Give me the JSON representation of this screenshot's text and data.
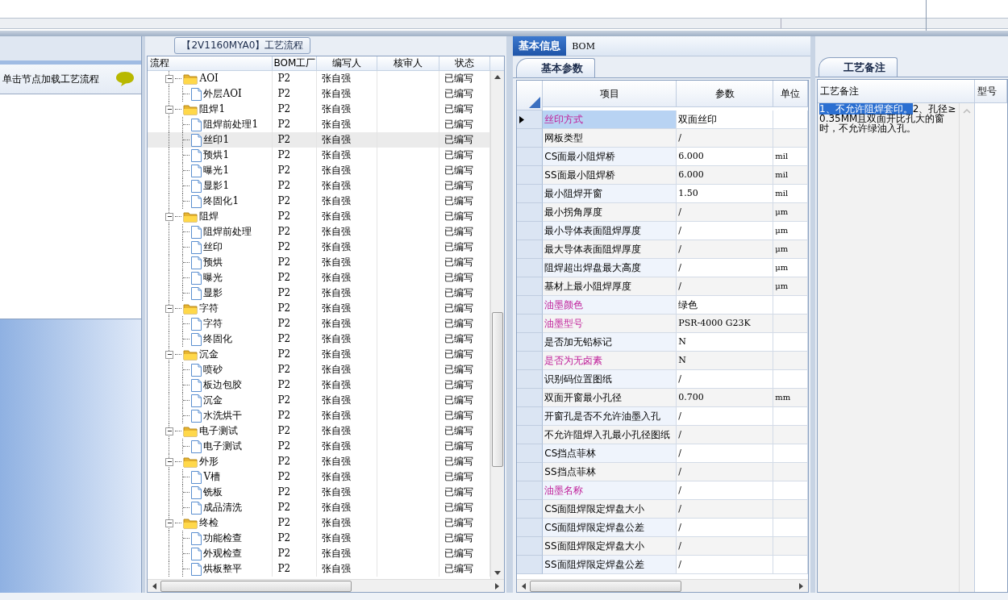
{
  "hint_panel": {
    "text": "单击节点加载工艺流程"
  },
  "flow_panel": {
    "title": "【2V1160MYA0】工艺流程",
    "columns": [
      "流程",
      "BOM工厂",
      "编写人",
      "核审人",
      "状态"
    ],
    "tree": [
      {
        "name": "AOI",
        "bom": "P2",
        "writer": "张自强",
        "status": "已编写",
        "expanded": true,
        "selected": false,
        "children": [
          {
            "name": "外层AOI",
            "bom": "P2",
            "writer": "张自强",
            "status": "已编写",
            "selected": false
          }
        ]
      },
      {
        "name": "阻焊1",
        "bom": "P2",
        "writer": "张自强",
        "status": "已编写",
        "expanded": true,
        "selected": false,
        "children": [
          {
            "name": "阻焊前处理1",
            "bom": "P2",
            "writer": "张自强",
            "status": "已编写",
            "selected": false
          },
          {
            "name": "丝印1",
            "bom": "P2",
            "writer": "张自强",
            "status": "已编写",
            "selected": true
          },
          {
            "name": "预烘1",
            "bom": "P2",
            "writer": "张自强",
            "status": "已编写",
            "selected": false
          },
          {
            "name": "曝光1",
            "bom": "P2",
            "writer": "张自强",
            "status": "已编写",
            "selected": false
          },
          {
            "name": "显影1",
            "bom": "P2",
            "writer": "张自强",
            "status": "已编写",
            "selected": false
          },
          {
            "name": "终固化1",
            "bom": "P2",
            "writer": "张自强",
            "status": "已编写",
            "selected": false
          }
        ]
      },
      {
        "name": "阻焊",
        "bom": "P2",
        "writer": "张自强",
        "status": "已编写",
        "expanded": true,
        "selected": false,
        "children": [
          {
            "name": "阻焊前处理",
            "bom": "P2",
            "writer": "张自强",
            "status": "已编写",
            "selected": false
          },
          {
            "name": "丝印",
            "bom": "P2",
            "writer": "张自强",
            "status": "已编写",
            "selected": false
          },
          {
            "name": "预烘",
            "bom": "P2",
            "writer": "张自强",
            "status": "已编写",
            "selected": false
          },
          {
            "name": "曝光",
            "bom": "P2",
            "writer": "张自强",
            "status": "已编写",
            "selected": false
          },
          {
            "name": "显影",
            "bom": "P2",
            "writer": "张自强",
            "status": "已编写",
            "selected": false
          }
        ]
      },
      {
        "name": "字符",
        "bom": "P2",
        "writer": "张自强",
        "status": "已编写",
        "expanded": true,
        "selected": false,
        "children": [
          {
            "name": "字符",
            "bom": "P2",
            "writer": "张自强",
            "status": "已编写",
            "selected": false
          },
          {
            "name": "终固化",
            "bom": "P2",
            "writer": "张自强",
            "status": "已编写",
            "selected": false
          }
        ]
      },
      {
        "name": "沉金",
        "bom": "P2",
        "writer": "张自强",
        "status": "已编写",
        "expanded": true,
        "selected": false,
        "children": [
          {
            "name": "喷砂",
            "bom": "P2",
            "writer": "张自强",
            "status": "已编写",
            "selected": false
          },
          {
            "name": "板边包胶",
            "bom": "P2",
            "writer": "张自强",
            "status": "已编写",
            "selected": false
          },
          {
            "name": "沉金",
            "bom": "P2",
            "writer": "张自强",
            "status": "已编写",
            "selected": false
          },
          {
            "name": "水洗烘干",
            "bom": "P2",
            "writer": "张自强",
            "status": "已编写",
            "selected": false
          }
        ]
      },
      {
        "name": "电子测试",
        "bom": "P2",
        "writer": "张自强",
        "status": "已编写",
        "expanded": true,
        "selected": false,
        "children": [
          {
            "name": "电子测试",
            "bom": "P2",
            "writer": "张自强",
            "status": "已编写",
            "selected": false
          }
        ]
      },
      {
        "name": "外形",
        "bom": "P2",
        "writer": "张自强",
        "status": "已编写",
        "expanded": true,
        "selected": false,
        "children": [
          {
            "name": "V槽",
            "bom": "P2",
            "writer": "张自强",
            "status": "已编写",
            "selected": false
          },
          {
            "name": "铣板",
            "bom": "P2",
            "writer": "张自强",
            "status": "已编写",
            "selected": false
          },
          {
            "name": "成品清洗",
            "bom": "P2",
            "writer": "张自强",
            "status": "已编写",
            "selected": false
          }
        ]
      },
      {
        "name": "终检",
        "bom": "P2",
        "writer": "张自强",
        "status": "已编写",
        "expanded": true,
        "selected": false,
        "children": [
          {
            "name": "功能检查",
            "bom": "P2",
            "writer": "张自强",
            "status": "已编写",
            "selected": false
          },
          {
            "name": "外观检查",
            "bom": "P2",
            "writer": "张自强",
            "status": "已编写",
            "selected": false
          },
          {
            "name": "烘板整平",
            "bom": "P2",
            "writer": "张自强",
            "status": "已编写",
            "selected": false
          }
        ]
      }
    ]
  },
  "tabs": [
    {
      "label": "基本信息",
      "selected": true
    },
    {
      "label": "BOM",
      "selected": false
    }
  ],
  "sub_tab": {
    "label": "基本参数"
  },
  "params": {
    "columns": [
      "项目",
      "参数",
      "单位"
    ],
    "rows": [
      {
        "item": "丝印方式",
        "value": "双面丝印",
        "emphasized": true,
        "selected": true
      },
      {
        "item": "网板类型",
        "value": "/",
        "emphasized": false,
        "selected": false
      },
      {
        "item": "CS面最小阻焊桥",
        "value": "6.000",
        "unit": "mil",
        "emphasized": false,
        "selected": false
      },
      {
        "item": "SS面最小阻焊桥",
        "value": "6.000",
        "unit": "mil",
        "emphasized": false,
        "selected": false
      },
      {
        "item": "最小阻焊开窗",
        "value": "1.50",
        "unit": "mil",
        "emphasized": false,
        "selected": false
      },
      {
        "item": "最小拐角厚度",
        "value": "/",
        "unit": "μm",
        "emphasized": false,
        "selected": false
      },
      {
        "item": "最小导体表面阻焊厚度",
        "value": "/",
        "unit": "μm",
        "emphasized": false,
        "selected": false
      },
      {
        "item": "最大导体表面阻焊厚度",
        "value": "/",
        "unit": "μm",
        "emphasized": false,
        "selected": false
      },
      {
        "item": "阻焊超出焊盘最大高度",
        "value": "/",
        "unit": "μm",
        "emphasized": false,
        "selected": false
      },
      {
        "item": "基材上最小阻焊厚度",
        "value": "/",
        "unit": "μm",
        "emphasized": false,
        "selected": false
      },
      {
        "item": "油墨颜色",
        "value": "绿色",
        "emphasized": true,
        "selected": false
      },
      {
        "item": "油墨型号",
        "value": "PSR-4000 G23K",
        "emphasized": true,
        "selected": false
      },
      {
        "item": "是否加无铅标记",
        "value": "N",
        "emphasized": false,
        "selected": false
      },
      {
        "item": "是否为无卤素",
        "value": "N",
        "emphasized": true,
        "selected": false
      },
      {
        "item": "识别码位置图纸",
        "value": "/",
        "emphasized": false,
        "selected": false
      },
      {
        "item": "双面开窗最小孔径",
        "value": "0.700",
        "unit": "mm",
        "emphasized": false,
        "selected": false
      },
      {
        "item": "开窗孔是否不允许油墨入孔",
        "value": "/",
        "emphasized": false,
        "selected": false
      },
      {
        "item": "不允许阻焊入孔最小孔径图纸",
        "value": "/",
        "emphasized": false,
        "selected": false
      },
      {
        "item": "CS挡点菲林",
        "value": "/",
        "emphasized": false,
        "selected": false
      },
      {
        "item": "SS挡点菲林",
        "value": "/",
        "emphasized": false,
        "selected": false
      },
      {
        "item": "油墨名称",
        "value": "/",
        "emphasized": true,
        "selected": false
      },
      {
        "item": "CS面阻焊限定焊盘大小",
        "value": "/",
        "emphasized": false,
        "selected": false
      },
      {
        "item": "CS面阻焊限定焊盘公差",
        "value": "/",
        "emphasized": false,
        "selected": false
      },
      {
        "item": "SS面阻焊限定焊盘大小",
        "value": "/",
        "emphasized": false,
        "selected": false
      },
      {
        "item": "SS面阻焊限定焊盘公差",
        "value": "/",
        "emphasized": false,
        "selected": false
      }
    ]
  },
  "notes_panel": {
    "tab": "工艺备注",
    "columns": [
      "工艺备注",
      "型号"
    ],
    "selected_text": "1、不允许阻焊套印。",
    "text": "2、孔径≥0.35MM且双面开比孔大的窗时，不允许绿油入孔。"
  }
}
